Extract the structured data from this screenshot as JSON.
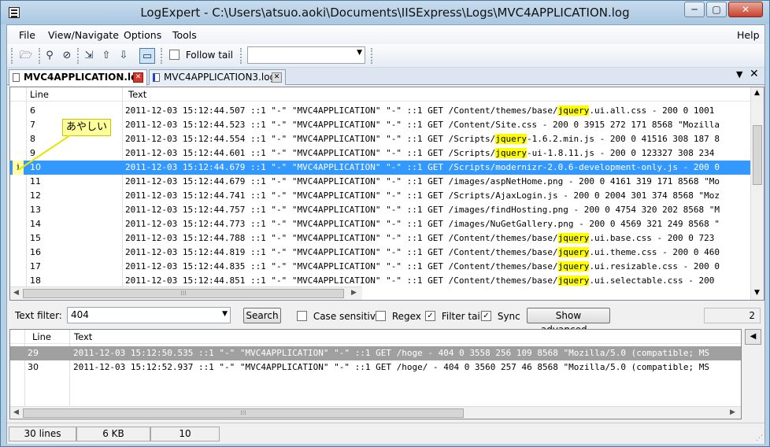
{
  "window": {
    "title": "LogExpert - C:\\Users\\atsuo.aoki\\Documents\\IISExpress\\Logs\\MVC4APPLICATION.log",
    "minimize": "─",
    "maximize": "▢",
    "close": "✕"
  },
  "menu": {
    "file": "File",
    "view": "View/Navigate",
    "options": "Options",
    "tools": "Tools",
    "help": "Help"
  },
  "toolbar": {
    "follow_tail_label": "Follow tail",
    "icons": [
      "open-folder-icon",
      "search-icon",
      "filter-search-icon",
      "go-to-line-icon",
      "bookmark-prev-icon",
      "bookmark-next-icon",
      "bubble-icon"
    ]
  },
  "tabs": [
    {
      "label": "MVC4APPLICATION.log",
      "active": true
    },
    {
      "label": "MVC4APPLICATION3.log",
      "active": false
    }
  ],
  "log_grid": {
    "col_line": "Line",
    "col_text": "Text",
    "bookmark_callout": "あやしい",
    "rows": [
      {
        "line": "6",
        "pre": "2011-12-03 15:12:44.507 ::1 \"-\" \"MVC4APPLICATION\" \"-\" ::1 GET /Content/themes/base/",
        "hl": "jquery",
        "post": ".ui.all.css - 200 0 1001"
      },
      {
        "line": "7",
        "pre": "2011-12-03 15:12:44.523 ::1 \"-\" \"MVC4APPLICATION\" \"-\" ::1 GET /Content/Site.css - 200 0 3915 272 171 8568 \"Mozilla",
        "hl": "",
        "post": ""
      },
      {
        "line": "8",
        "pre": "2011-12-03 15:12:44.554 ::1 \"-\" \"MVC4APPLICATION\" \"-\" ::1 GET /Scripts/",
        "hl": "jquery",
        "post": "-1.6.2.min.js - 200 0 41516 308 187 8"
      },
      {
        "line": "9",
        "pre": "2011-12-03 15:12:44.601 ::1 \"-\" \"MVC4APPLICATION\" \"-\" ::1 GET /Scripts/",
        "hl": "jquery",
        "post": "-ui-1.8.11.js - 200 0 123327 308 234"
      },
      {
        "line": "10",
        "pre": "2011-12-03 15:12:44.679 ::1 \"-\" \"MVC4APPLICATION\" \"-\" ::1 GET /Scripts/modernizr-2.0.6-development-only.js - 200 0",
        "hl": "",
        "post": ""
      },
      {
        "line": "11",
        "pre": "2011-12-03 15:12:44.679 ::1 \"-\" \"MVC4APPLICATION\" \"-\" ::1 GET /images/aspNetHome.png - 200 0 4161 319 171 8568 \"Mo",
        "hl": "",
        "post": ""
      },
      {
        "line": "12",
        "pre": "2011-12-03 15:12:44.741 ::1 \"-\" \"MVC4APPLICATION\" \"-\" ::1 GET /Scripts/AjaxLogin.js - 200 0 2004 301 374 8568 \"Moz",
        "hl": "",
        "post": ""
      },
      {
        "line": "13",
        "pre": "2011-12-03 15:12:44.757 ::1 \"-\" \"MVC4APPLICATION\" \"-\" ::1 GET /images/findHosting.png - 200 0 4754 320 202 8568 \"M",
        "hl": "",
        "post": ""
      },
      {
        "line": "14",
        "pre": "2011-12-03 15:12:44.773 ::1 \"-\" \"MVC4APPLICATION\" \"-\" ::1 GET /images/NuGetGallery.png - 200 0 4569 321 249 8568 \"",
        "hl": "",
        "post": ""
      },
      {
        "line": "15",
        "pre": "2011-12-03 15:12:44.788 ::1 \"-\" \"MVC4APPLICATION\" \"-\" ::1 GET /Content/themes/base/",
        "hl": "jquery",
        "post": ".ui.base.css - 200 0 723"
      },
      {
        "line": "16",
        "pre": "2011-12-03 15:12:44.819 ::1 \"-\" \"MVC4APPLICATION\" \"-\" ::1 GET /Content/themes/base/",
        "hl": "jquery",
        "post": ".ui.theme.css - 200 0 460"
      },
      {
        "line": "17",
        "pre": "2011-12-03 15:12:44.835 ::1 \"-\" \"MVC4APPLICATION\" \"-\" ::1 GET /Content/themes/base/",
        "hl": "jquery",
        "post": ".ui.resizable.css - 200 0"
      },
      {
        "line": "18",
        "pre": "2011-12-03 15:12:44.851 ::1 \"-\" \"MVC4APPLICATION\" \"-\" ::1 GET /Content/themes/base/",
        "hl": "jquery",
        "post": ".ui.selectable.css - 200"
      }
    ],
    "selected_line": "10",
    "bookmark_marker": "i"
  },
  "filter": {
    "label": "Text filter:",
    "value": "404",
    "search_button": "Search",
    "case_sensitive": {
      "label": "Case sensitive",
      "checked": false
    },
    "regex": {
      "label": "Regex",
      "checked": false
    },
    "filter_tail": {
      "label": "Filter tail",
      "checked": true
    },
    "sync": {
      "label": "Sync",
      "checked": true
    },
    "advanced_button": "Show advanced...",
    "count": "2"
  },
  "filter_grid": {
    "col_line": "Line",
    "col_text": "Text",
    "rows": [
      {
        "line": "29",
        "text": "2011-12-03 15:12:50.535 ::1 \"-\" \"MVC4APPLICATION\" \"-\" ::1 GET /hoge - 404 0 3558 256 109 8568 \"Mozilla/5.0 (compatible; MS"
      },
      {
        "line": "30",
        "text": "2011-12-03 15:12:52.937 ::1 \"-\" \"MVC4APPLICATION\" \"-\" ::1 GET /hoge/ - 404 0 3560 257 46 8568 \"Mozilla/5.0 (compatible; MS"
      }
    ]
  },
  "status": {
    "lines": "30 lines",
    "size": "6 KB",
    "current": "10"
  },
  "colors": {
    "selection": "#3399ff",
    "highlight": "#ffff00",
    "filter_selection": "#a0a0a0"
  }
}
